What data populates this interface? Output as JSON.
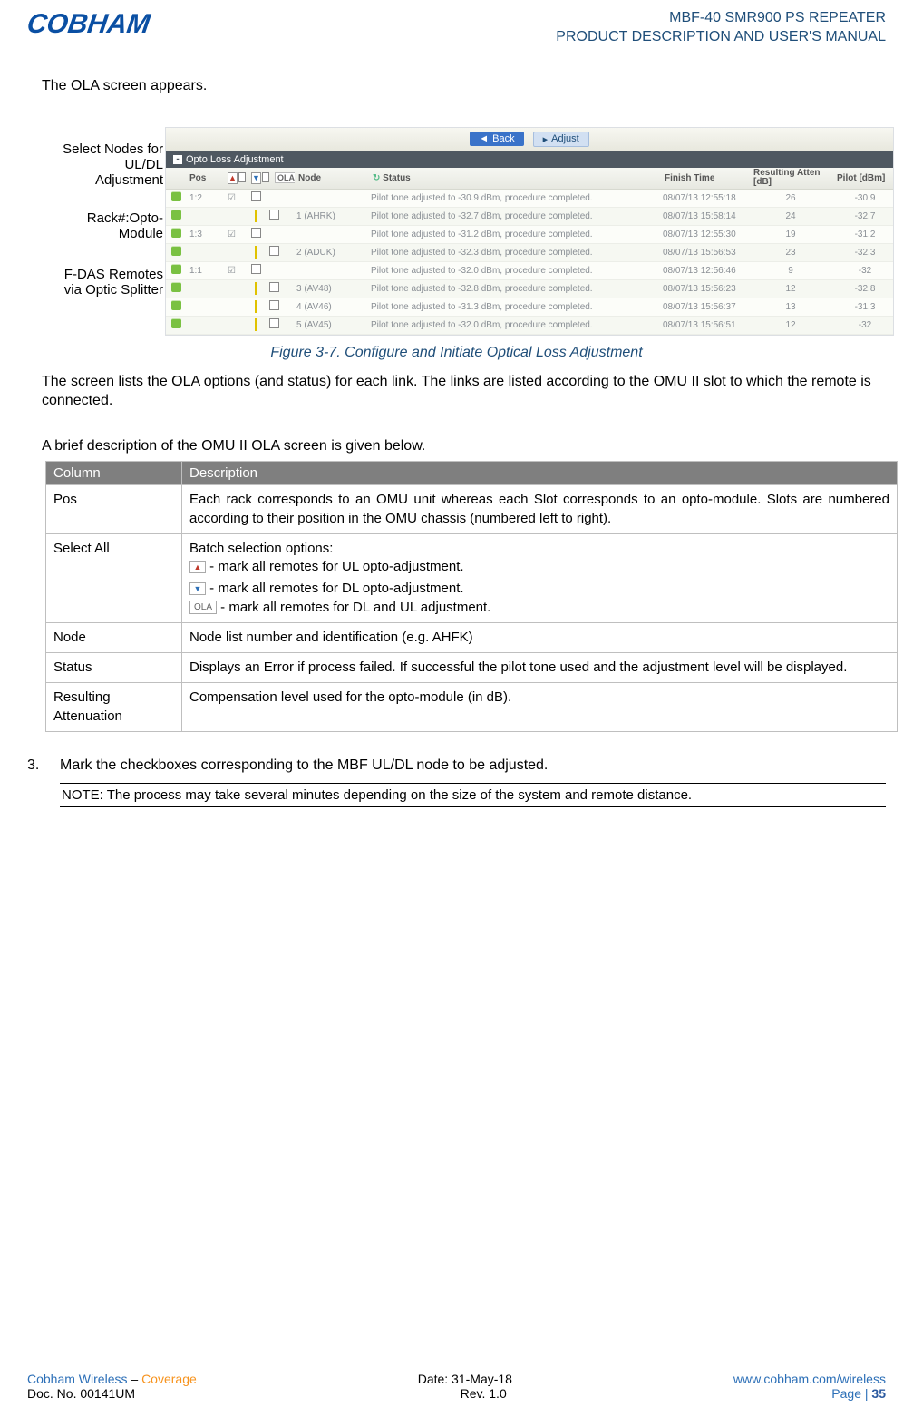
{
  "header": {
    "logo_text": "COBHAM",
    "title_line1": "MBF-40 SMR900 PS REPEATER",
    "title_line2": "PRODUCT DESCRIPTION AND USER'S MANUAL"
  },
  "intro": "The OLA screen appears.",
  "annotations": {
    "a1_l1": "Select Nodes  for",
    "a1_l2": "UL/DL",
    "a1_l3": "Adjustment",
    "a2_l1": "Rack#:Opto-",
    "a2_l2": "Module",
    "a3_l1": "F-DAS Remotes",
    "a3_l2": "via Optic Splitter"
  },
  "screenshot": {
    "back_label": "Back",
    "adjust_label": "Adjust",
    "panel_title": "Opto Loss Adjustment",
    "col_pos": "Pos",
    "col_ola": "OLA",
    "col_node": "Node",
    "col_status": "Status",
    "col_finish": "Finish Time",
    "col_atten": "Resulting Atten [dB]",
    "col_pilot": "Pilot [dBm]",
    "status_icon_label": "↻",
    "rows": [
      {
        "pos": "1:2",
        "chk": "☑",
        "tree": "",
        "node": "",
        "status": "Pilot tone adjusted to -30.9 dBm, procedure completed.",
        "finish": "08/07/13 12:55:18",
        "att": "26",
        "pilot": "-30.9"
      },
      {
        "pos": "",
        "chk": "",
        "tree": "├",
        "node": "1 (AHRK)",
        "status": "Pilot tone adjusted to -32.7 dBm, procedure completed.",
        "finish": "08/07/13 15:58:14",
        "att": "24",
        "pilot": "-32.7"
      },
      {
        "pos": "1:3",
        "chk": "☑",
        "tree": "",
        "node": "",
        "status": "Pilot tone adjusted to -31.2 dBm, procedure completed.",
        "finish": "08/07/13 12:55:30",
        "att": "19",
        "pilot": "-31.2"
      },
      {
        "pos": "",
        "chk": "",
        "tree": "├",
        "node": "2 (ADUK)",
        "status": "Pilot tone adjusted to -32.3 dBm, procedure completed.",
        "finish": "08/07/13 15:56:53",
        "att": "23",
        "pilot": "-32.3"
      },
      {
        "pos": "1:1",
        "chk": "☑",
        "tree": "",
        "node": "",
        "status": "Pilot tone adjusted to -32.0 dBm, procedure completed.",
        "finish": "08/07/13 12:56:46",
        "att": "9",
        "pilot": "-32"
      },
      {
        "pos": "",
        "chk": "",
        "tree": "├",
        "node": "3 (AV48)",
        "status": "Pilot tone adjusted to -32.8 dBm, procedure completed.",
        "finish": "08/07/13 15:56:23",
        "att": "12",
        "pilot": "-32.8"
      },
      {
        "pos": "",
        "chk": "",
        "tree": "├",
        "node": "4 (AV46)",
        "status": "Pilot tone adjusted to -31.3 dBm, procedure completed.",
        "finish": "08/07/13 15:56:37",
        "att": "13",
        "pilot": "-31.3"
      },
      {
        "pos": "",
        "chk": "",
        "tree": "└",
        "node": "5 (AV45)",
        "status": "Pilot tone adjusted to -32.0 dBm, procedure completed.",
        "finish": "08/07/13 15:56:51",
        "att": "12",
        "pilot": "-32"
      }
    ]
  },
  "caption": "Figure 3-7.  Configure and Initiate Optical Loss Adjustment",
  "para1": "The screen lists the OLA options (and status) for each link. The links are listed according to the OMU II slot to which the remote is connected.",
  "para2": "A brief description of the OMU II OLA screen is given below.",
  "table": {
    "h1": "Column",
    "h2": "Description",
    "r1c1": "Pos",
    "r1c2": "Each rack corresponds to an OMU unit whereas each Slot corresponds to an opto-module. Slots are numbered according to their position in the OMU chassis (numbered left to right).",
    "r2c1": "Select All",
    "r2_intro": "Batch selection options:",
    "r2_up": " - mark all remotes for UL opto-adjustment.",
    "r2_dn": " - mark all remotes for DL opto-adjustment.",
    "r2_ola_label": "OLA",
    "r2_ola": " - mark all remotes for DL and UL adjustment.",
    "r3c1": "Node",
    "r3c2": "Node list number and identification (e.g. AHFK)",
    "r4c1": "Status",
    "r4c2": "Displays an Error if process failed. If successful the pilot tone used and the adjustment level will be displayed.",
    "r5c1": "Resulting Attenuation",
    "r5c2": "Compensation level used for the opto-module (in dB)."
  },
  "step3_num": "3.",
  "step3": "Mark the checkboxes corresponding to the MBF UL/DL node to be adjusted.",
  "note": "NOTE: The process may take several minutes depending on the size of the system and remote distance.",
  "footer": {
    "l1a": "Cobham Wireless",
    "l1dash": " – ",
    "l1b": "Coverage",
    "date": "Date: 31-May-18",
    "url": "www.cobham.com/wireless",
    "doc": "Doc. No. 00141UM",
    "rev": "Rev. 1.0",
    "page_lbl": "Page | ",
    "page_no": "35"
  }
}
